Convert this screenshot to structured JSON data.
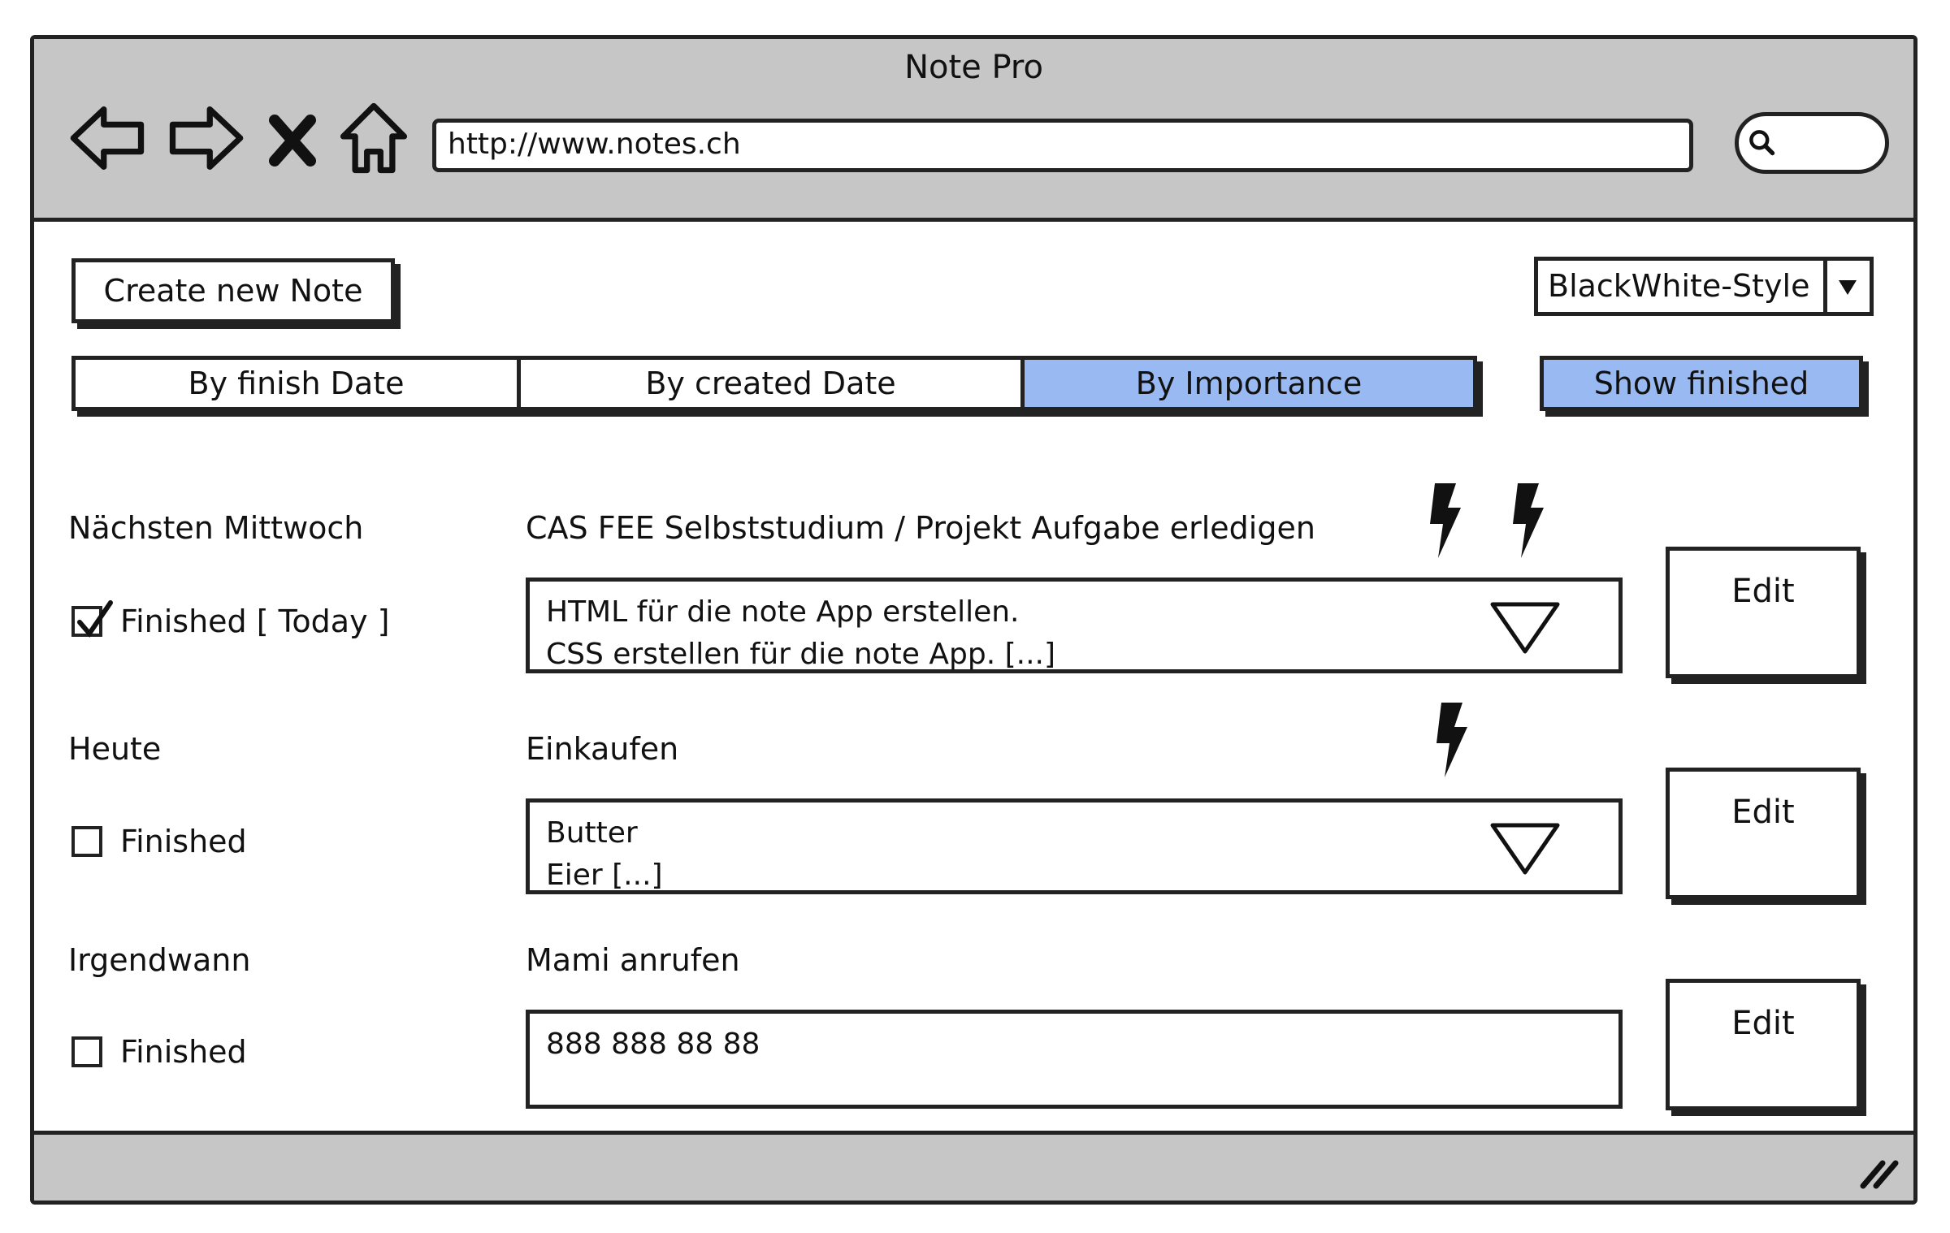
{
  "window": {
    "title": "Note Pro",
    "url": "http://www.notes.ch",
    "nav_icons": [
      "back-arrow-icon",
      "forward-arrow-icon",
      "close-x-icon",
      "home-icon"
    ],
    "search_icon": "search-icon"
  },
  "toolbar": {
    "create_label": "Create new Note",
    "style_selected": "BlackWhite-Style"
  },
  "sort_tabs": [
    {
      "label": "By finish Date",
      "active": false
    },
    {
      "label": "By created Date",
      "active": false
    },
    {
      "label": "By Importance",
      "active": true
    }
  ],
  "show_finished_label": "Show finished",
  "accent_color": "#98b9f2",
  "notes": [
    {
      "due": "Nächsten Mittwoch",
      "title": "CAS FEE Selbststudium / Projekt Aufgabe erledigen",
      "importance": 2,
      "finished": true,
      "finished_label": "Finished [ Today ]",
      "description": [
        "HTML für die note App erstellen.",
        "CSS erstellen für die note App. [...]"
      ],
      "expandable": true,
      "edit_label": "Edit"
    },
    {
      "due": "Heute",
      "title": "Einkaufen",
      "importance": 1,
      "finished": false,
      "finished_label": "Finished",
      "description": [
        "Butter",
        "Eier [...]"
      ],
      "expandable": true,
      "edit_label": "Edit"
    },
    {
      "due": "Irgendwann",
      "title": "Mami anrufen",
      "importance": 0,
      "finished": false,
      "finished_label": "Finished",
      "description": [
        "888 888 88 88"
      ],
      "expandable": false,
      "edit_label": "Edit"
    }
  ]
}
